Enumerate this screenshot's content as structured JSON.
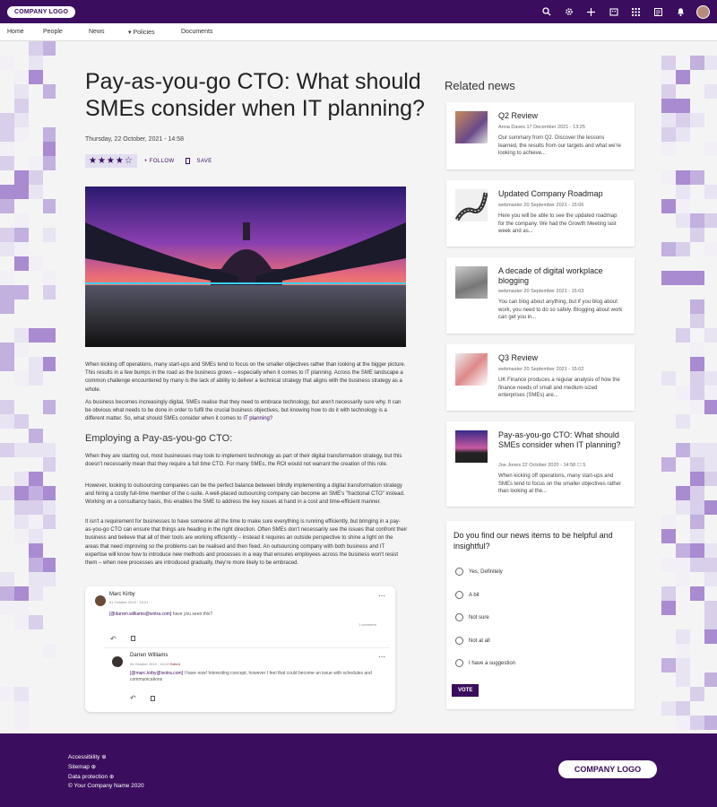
{
  "header": {
    "logo": "COMPANY LOGO",
    "icons": [
      "search-icon",
      "gear-icon",
      "plus-icon",
      "building-icon",
      "apps-grid-icon",
      "news-icon",
      "bell-icon",
      "avatar"
    ]
  },
  "nav": {
    "items": [
      "Home",
      "People",
      "News",
      "▾ Policies",
      "Documents"
    ]
  },
  "article": {
    "title": "Pay-as-you-go CTO: What should SMEs consider when IT planning?",
    "date": "Thursday, 22 October, 2021 - 14:58",
    "stars": "★★★★☆",
    "follow": "+ FOLLOW",
    "save": "SAVE",
    "p1": "When kicking off operations, many start-ups and SMEs tend to focus on the smaller objectives rather than looking at the bigger picture. This results in a few bumps in the road as the business grows – especially when it comes to IT planning. Across the SME landscape a common challenge encountered by many is the lack of ability to deliver a technical strategy that aligns with the business strategy as a whole.",
    "p2_a": "As business becomes increasingly digital, SMEs realise that they need to embrace technology, but aren't necessarily sure why. It can be obvious what needs to be done in order to fulfil the crucial business objectives, but knowing how to do it with technology is a different matter. So, what should SMEs consider when it comes to ",
    "p2_link": "IT planning",
    "p2_b": "?",
    "h2": "Employing a Pay-as-you-go CTO:",
    "p3": "When they are starting out, most businesses may look to implement technology as part of their digital transformation strategy, but this doesn't necessarily mean that they require a full time CTO. For many SMEs, the ROI would not warrant the creation of this role.",
    "p4": "However, looking to outsourcing companies can be the perfect balance between blindly implementing a digital transformation strategy and hiring a costly full-time member of the c-suite. A well-placed outsourcing company can become an SME's \"fractional CTO\" instead. Working on a consultancy basis, this enables the SME to address the key issues at hand in a cost and time-efficient manner.",
    "p5": "It isn't a requirement for businesses to have someone all the time to make sure everything is running efficiently, but bringing in a pay-as-you-go CTO can ensure that things are heading in the right direction. Often SMEs don't necessarily see the issues that confront their business and believe that all of their tools are working efficiently – instead it requires an outside perspective to shine a light on the areas that need improving so the problems can be realised and then fixed. An outsourcing company with both business and IT expertise will know how to introduce new methods and processes in a way that ensures employees across the business won't resist them – when new processes are introduced gradually, they're more likely to be embraced."
  },
  "comments": [
    {
      "name": "Marc Kirby",
      "date": "01 October 2019 - 15:21",
      "mention": "[@darren.williams@ivotra.com]",
      "text": " have you seen this?",
      "count": "1 comment"
    },
    {
      "name": "Darren Williams",
      "date": "04 October 2019 - 16:24",
      "edited": "Edited",
      "mention": "[@marc.kirby@ivotra.com]",
      "text": " I have now! Interesting concept, however I feel that could become an issue with schedules and communications"
    }
  ],
  "related": {
    "title": "Related news",
    "items": [
      {
        "title": "Q2 Review",
        "meta": "Anna Daves 17 December 2021 - 13:25",
        "summary": "Our summary from Q2. Discover the lessons learned, the results from our targets and what we're looking to achieve..."
      },
      {
        "title": "Updated Company Roadmap",
        "meta": "webmaster 20 September 2021 - 15:06",
        "summary": "Here you will be able to see the updated roadmap for the company. We had the Growth Meeting last week and as..."
      },
      {
        "title": "A decade of digital workplace blogging",
        "meta": "webmaster 20 September 2021 - 15:03",
        "summary": "You can blog about anything, but if you blog about work, you need to do so safely. Blogging about work can get you in..."
      },
      {
        "title": "Q3 Review",
        "meta": "webmaster 20 September 2021 - 15:02",
        "summary": "UK Finance produces a regular analysis of how the finance needs of small and medium-sized enterprises (SMEs) are..."
      },
      {
        "title": "Pay-as-you-go CTO: What should SMEs consider when IT planning?",
        "meta": "Joe Jones 22 October 2020 - 14:58 ☐ 5",
        "summary": "When kicking off operations, many start-ups and SMEs tend to focus on the smaller objectives rather than looking at the..."
      }
    ]
  },
  "poll": {
    "question": "Do you find our news items to be helpful and insightful?",
    "options": [
      "Yes, Definitely",
      "A bit",
      "Not sure",
      "Not at all",
      "I have a suggestion"
    ],
    "vote": "VOTE"
  },
  "footer": {
    "links": [
      "Accessibility ⊕",
      "Sitemap ⊕",
      "Data protection ⊕",
      "© Your Company Name 2020"
    ],
    "logo": "COMPANY LOGO"
  },
  "colors": {
    "brand": "#3b0d5e",
    "accent": "#7c4ec0"
  }
}
